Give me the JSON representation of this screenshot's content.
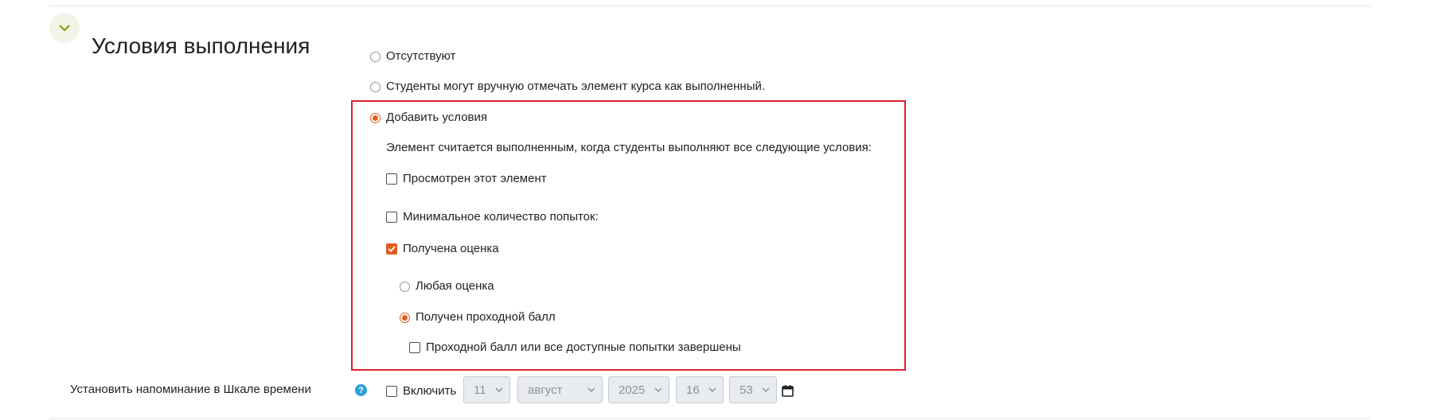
{
  "section": {
    "title": "Условия выполнения",
    "toggle_icon": "chevron-down-icon"
  },
  "completion_options": {
    "none_label": "Отсутствуют",
    "manual_label": "Студенты могут вручную отмечать элемент курса как выполненный.",
    "conditions_label": "Добавить условия",
    "selected": "conditions"
  },
  "conditions": {
    "intro": "Элемент считается выполненным, когда студенты выполняют все следующие условия:",
    "viewed_label": "Просмотрен этот элемент",
    "viewed_checked": false,
    "min_attempts_label": "Минимальное количество попыток:",
    "min_attempts_checked": false,
    "grade_received_label": "Получена оценка",
    "grade_received_checked": true,
    "any_grade_label": "Любая оценка",
    "passing_grade_label": "Получен проходной балл",
    "grade_selected": "passing",
    "pass_or_attempts_label": "Проходной балл или все доступные попытки завершены",
    "pass_or_attempts_checked": false
  },
  "reminder": {
    "label": "Установить напоминание в Шкале времени",
    "enable_label": "Включить",
    "enable_checked": false,
    "day": "11",
    "month": "август",
    "year": "2025",
    "hour": "16",
    "minute": "53"
  },
  "colors": {
    "accent": "#e35b20",
    "highlight_border": "#d9222f",
    "help_icon": "#2b9fd9",
    "toggle_bg": "#f1f4e6"
  }
}
